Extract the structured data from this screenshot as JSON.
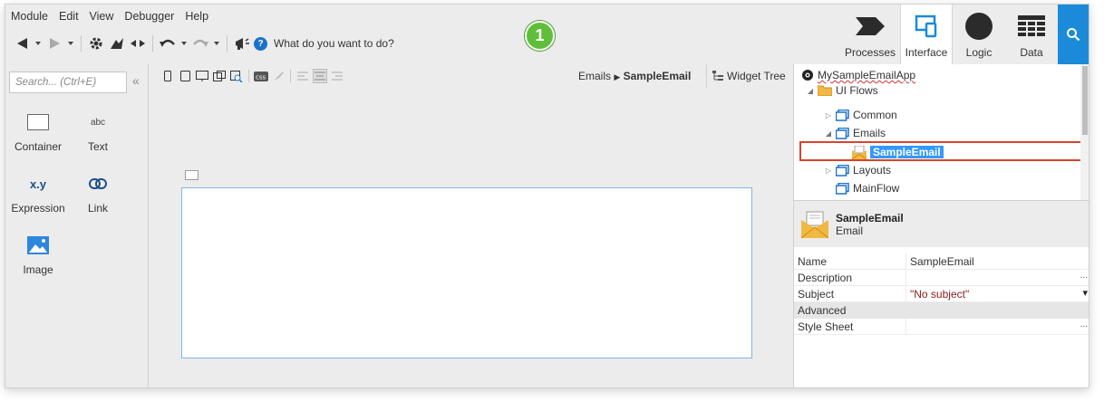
{
  "menu": [
    "Module",
    "Edit",
    "View",
    "Debugger",
    "Help"
  ],
  "toolbar": {
    "help_text": "What do you want to do?",
    "icons": [
      "back-arrow-icon",
      "forward-arrow-icon",
      "gear-icon",
      "publish-icon",
      "compare-icon",
      "undo-icon",
      "redo-icon",
      "announce-icon",
      "help-icon"
    ]
  },
  "step_badge": "1",
  "app_tabs": [
    {
      "label": "Processes"
    },
    {
      "label": "Interface"
    },
    {
      "label": "Logic"
    },
    {
      "label": "Data"
    }
  ],
  "left_panel": {
    "search_placeholder": "Search... (Ctrl+E)",
    "collapse": "«",
    "widgets": [
      {
        "label": "Container",
        "glyph": ""
      },
      {
        "label": "Text",
        "glyph": "abc"
      },
      {
        "label": "Expression",
        "glyph": "x.y"
      },
      {
        "label": "Link",
        "glyph": ""
      },
      {
        "label": "Image",
        "glyph": ""
      }
    ]
  },
  "breadcrumb": {
    "parent": "Emails",
    "current": "SampleEmail"
  },
  "widget_tree_label": "Widget Tree",
  "tree": {
    "app": "MySampleEmailApp",
    "ui_flows": "UI Flows",
    "common": "Common",
    "emails": "Emails",
    "sample_email": "SampleEmail",
    "layouts": "Layouts",
    "mainflow": "MainFlow"
  },
  "details": {
    "title": "SampleEmail",
    "type": "Email"
  },
  "properties": {
    "name_label": "Name",
    "name_value": "SampleEmail",
    "description_label": "Description",
    "subject_label": "Subject",
    "subject_value": "\"No subject\"",
    "advanced_label": "Advanced",
    "stylesheet_label": "Style Sheet",
    "ellipsis": "...",
    "dropdown": "▾"
  },
  "colors": {
    "accent_blue": "#1b8ad8",
    "badge_green": "#5fbf3a",
    "highlight_red": "#d9432b",
    "selection_blue": "#3399ff"
  }
}
